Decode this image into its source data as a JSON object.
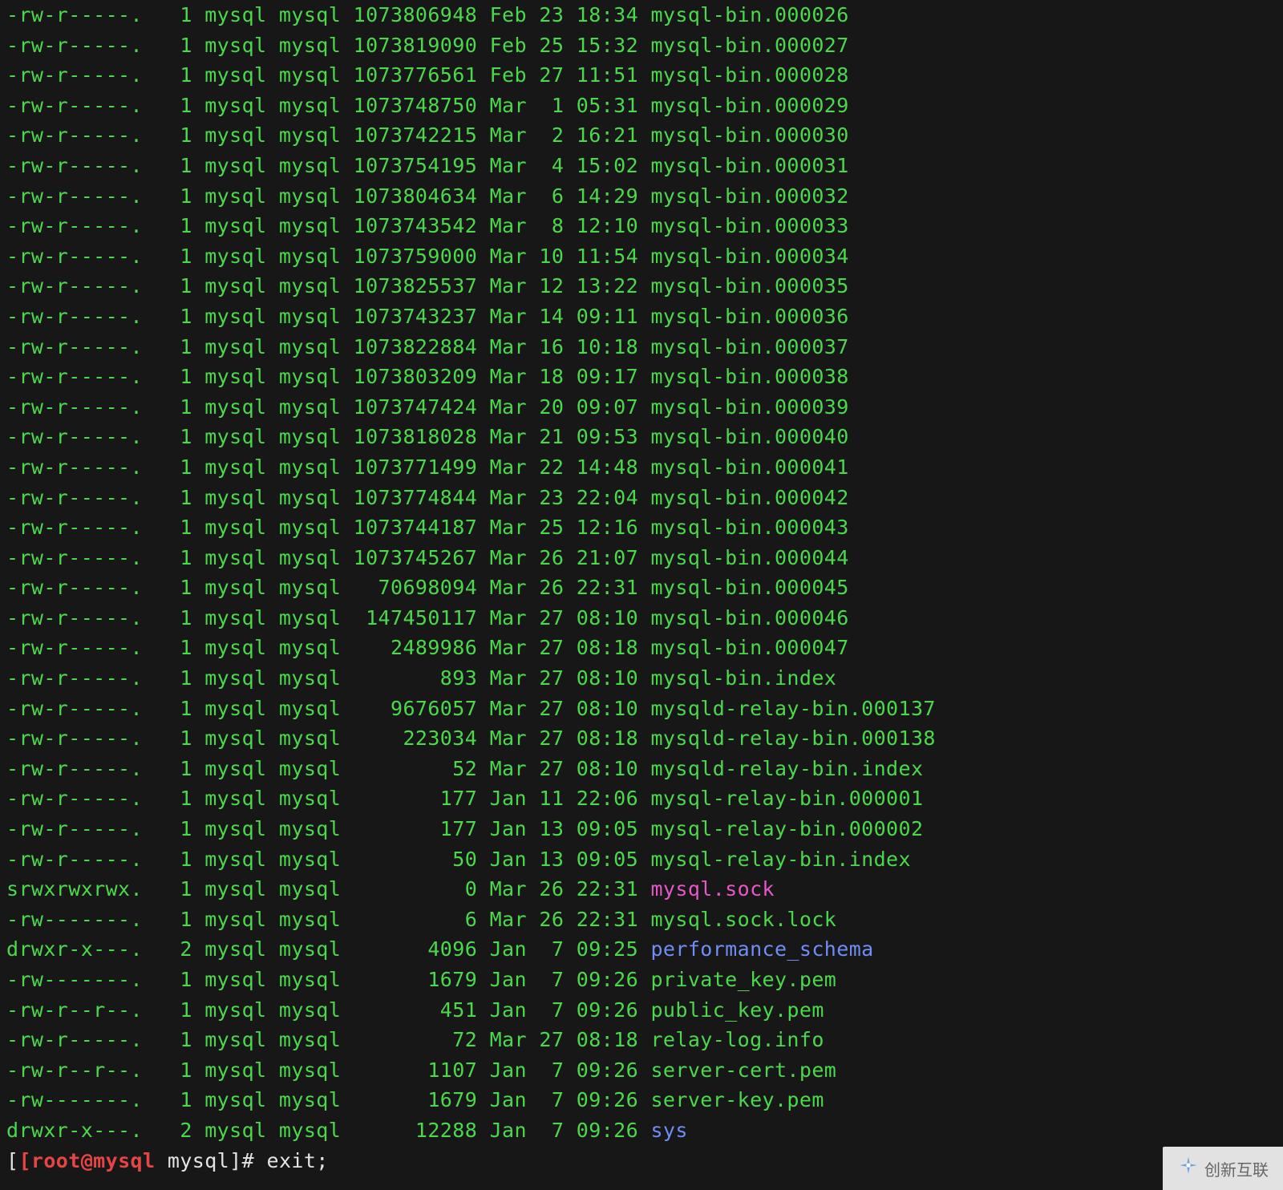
{
  "colors": {
    "fg": "#4bd94b",
    "magenta": "#e857c9",
    "blue": "#6f8ef5",
    "white": "#e4e4e4",
    "red": "#e74545",
    "bg": "#171717"
  },
  "listing": [
    {
      "perm": "-rw-r-----.",
      "links": "1",
      "owner": "mysql",
      "group": "mysql",
      "size": "1073806948",
      "date": "Feb 23 18:34",
      "name": "mysql-bin.000026",
      "cls": ""
    },
    {
      "perm": "-rw-r-----.",
      "links": "1",
      "owner": "mysql",
      "group": "mysql",
      "size": "1073819090",
      "date": "Feb 25 15:32",
      "name": "mysql-bin.000027",
      "cls": ""
    },
    {
      "perm": "-rw-r-----.",
      "links": "1",
      "owner": "mysql",
      "group": "mysql",
      "size": "1073776561",
      "date": "Feb 27 11:51",
      "name": "mysql-bin.000028",
      "cls": ""
    },
    {
      "perm": "-rw-r-----.",
      "links": "1",
      "owner": "mysql",
      "group": "mysql",
      "size": "1073748750",
      "date": "Mar  1 05:31",
      "name": "mysql-bin.000029",
      "cls": ""
    },
    {
      "perm": "-rw-r-----.",
      "links": "1",
      "owner": "mysql",
      "group": "mysql",
      "size": "1073742215",
      "date": "Mar  2 16:21",
      "name": "mysql-bin.000030",
      "cls": ""
    },
    {
      "perm": "-rw-r-----.",
      "links": "1",
      "owner": "mysql",
      "group": "mysql",
      "size": "1073754195",
      "date": "Mar  4 15:02",
      "name": "mysql-bin.000031",
      "cls": ""
    },
    {
      "perm": "-rw-r-----.",
      "links": "1",
      "owner": "mysql",
      "group": "mysql",
      "size": "1073804634",
      "date": "Mar  6 14:29",
      "name": "mysql-bin.000032",
      "cls": ""
    },
    {
      "perm": "-rw-r-----.",
      "links": "1",
      "owner": "mysql",
      "group": "mysql",
      "size": "1073743542",
      "date": "Mar  8 12:10",
      "name": "mysql-bin.000033",
      "cls": ""
    },
    {
      "perm": "-rw-r-----.",
      "links": "1",
      "owner": "mysql",
      "group": "mysql",
      "size": "1073759000",
      "date": "Mar 10 11:54",
      "name": "mysql-bin.000034",
      "cls": ""
    },
    {
      "perm": "-rw-r-----.",
      "links": "1",
      "owner": "mysql",
      "group": "mysql",
      "size": "1073825537",
      "date": "Mar 12 13:22",
      "name": "mysql-bin.000035",
      "cls": ""
    },
    {
      "perm": "-rw-r-----.",
      "links": "1",
      "owner": "mysql",
      "group": "mysql",
      "size": "1073743237",
      "date": "Mar 14 09:11",
      "name": "mysql-bin.000036",
      "cls": ""
    },
    {
      "perm": "-rw-r-----.",
      "links": "1",
      "owner": "mysql",
      "group": "mysql",
      "size": "1073822884",
      "date": "Mar 16 10:18",
      "name": "mysql-bin.000037",
      "cls": ""
    },
    {
      "perm": "-rw-r-----.",
      "links": "1",
      "owner": "mysql",
      "group": "mysql",
      "size": "1073803209",
      "date": "Mar 18 09:17",
      "name": "mysql-bin.000038",
      "cls": ""
    },
    {
      "perm": "-rw-r-----.",
      "links": "1",
      "owner": "mysql",
      "group": "mysql",
      "size": "1073747424",
      "date": "Mar 20 09:07",
      "name": "mysql-bin.000039",
      "cls": ""
    },
    {
      "perm": "-rw-r-----.",
      "links": "1",
      "owner": "mysql",
      "group": "mysql",
      "size": "1073818028",
      "date": "Mar 21 09:53",
      "name": "mysql-bin.000040",
      "cls": ""
    },
    {
      "perm": "-rw-r-----.",
      "links": "1",
      "owner": "mysql",
      "group": "mysql",
      "size": "1073771499",
      "date": "Mar 22 14:48",
      "name": "mysql-bin.000041",
      "cls": ""
    },
    {
      "perm": "-rw-r-----.",
      "links": "1",
      "owner": "mysql",
      "group": "mysql",
      "size": "1073774844",
      "date": "Mar 23 22:04",
      "name": "mysql-bin.000042",
      "cls": ""
    },
    {
      "perm": "-rw-r-----.",
      "links": "1",
      "owner": "mysql",
      "group": "mysql",
      "size": "1073744187",
      "date": "Mar 25 12:16",
      "name": "mysql-bin.000043",
      "cls": ""
    },
    {
      "perm": "-rw-r-----.",
      "links": "1",
      "owner": "mysql",
      "group": "mysql",
      "size": "1073745267",
      "date": "Mar 26 21:07",
      "name": "mysql-bin.000044",
      "cls": ""
    },
    {
      "perm": "-rw-r-----.",
      "links": "1",
      "owner": "mysql",
      "group": "mysql",
      "size": "70698094",
      "date": "Mar 26 22:31",
      "name": "mysql-bin.000045",
      "cls": ""
    },
    {
      "perm": "-rw-r-----.",
      "links": "1",
      "owner": "mysql",
      "group": "mysql",
      "size": "147450117",
      "date": "Mar 27 08:10",
      "name": "mysql-bin.000046",
      "cls": ""
    },
    {
      "perm": "-rw-r-----.",
      "links": "1",
      "owner": "mysql",
      "group": "mysql",
      "size": "2489986",
      "date": "Mar 27 08:18",
      "name": "mysql-bin.000047",
      "cls": ""
    },
    {
      "perm": "-rw-r-----.",
      "links": "1",
      "owner": "mysql",
      "group": "mysql",
      "size": "893",
      "date": "Mar 27 08:10",
      "name": "mysql-bin.index",
      "cls": ""
    },
    {
      "perm": "-rw-r-----.",
      "links": "1",
      "owner": "mysql",
      "group": "mysql",
      "size": "9676057",
      "date": "Mar 27 08:10",
      "name": "mysqld-relay-bin.000137",
      "cls": ""
    },
    {
      "perm": "-rw-r-----.",
      "links": "1",
      "owner": "mysql",
      "group": "mysql",
      "size": "223034",
      "date": "Mar 27 08:18",
      "name": "mysqld-relay-bin.000138",
      "cls": ""
    },
    {
      "perm": "-rw-r-----.",
      "links": "1",
      "owner": "mysql",
      "group": "mysql",
      "size": "52",
      "date": "Mar 27 08:10",
      "name": "mysqld-relay-bin.index",
      "cls": ""
    },
    {
      "perm": "-rw-r-----.",
      "links": "1",
      "owner": "mysql",
      "group": "mysql",
      "size": "177",
      "date": "Jan 11 22:06",
      "name": "mysql-relay-bin.000001",
      "cls": ""
    },
    {
      "perm": "-rw-r-----.",
      "links": "1",
      "owner": "mysql",
      "group": "mysql",
      "size": "177",
      "date": "Jan 13 09:05",
      "name": "mysql-relay-bin.000002",
      "cls": ""
    },
    {
      "perm": "-rw-r-----.",
      "links": "1",
      "owner": "mysql",
      "group": "mysql",
      "size": "50",
      "date": "Jan 13 09:05",
      "name": "mysql-relay-bin.index",
      "cls": ""
    },
    {
      "perm": "srwxrwxrwx.",
      "links": "1",
      "owner": "mysql",
      "group": "mysql",
      "size": "0",
      "date": "Mar 26 22:31",
      "name": "mysql.sock",
      "cls": "magenta"
    },
    {
      "perm": "-rw-------.",
      "links": "1",
      "owner": "mysql",
      "group": "mysql",
      "size": "6",
      "date": "Mar 26 22:31",
      "name": "mysql.sock.lock",
      "cls": ""
    },
    {
      "perm": "drwxr-x---.",
      "links": "2",
      "owner": "mysql",
      "group": "mysql",
      "size": "4096",
      "date": "Jan  7 09:25",
      "name": "performance_schema",
      "cls": "blue"
    },
    {
      "perm": "-rw-------.",
      "links": "1",
      "owner": "mysql",
      "group": "mysql",
      "size": "1679",
      "date": "Jan  7 09:26",
      "name": "private_key.pem",
      "cls": ""
    },
    {
      "perm": "-rw-r--r--.",
      "links": "1",
      "owner": "mysql",
      "group": "mysql",
      "size": "451",
      "date": "Jan  7 09:26",
      "name": "public_key.pem",
      "cls": ""
    },
    {
      "perm": "-rw-r-----.",
      "links": "1",
      "owner": "mysql",
      "group": "mysql",
      "size": "72",
      "date": "Mar 27 08:18",
      "name": "relay-log.info",
      "cls": ""
    },
    {
      "perm": "-rw-r--r--.",
      "links": "1",
      "owner": "mysql",
      "group": "mysql",
      "size": "1107",
      "date": "Jan  7 09:26",
      "name": "server-cert.pem",
      "cls": ""
    },
    {
      "perm": "-rw-------.",
      "links": "1",
      "owner": "mysql",
      "group": "mysql",
      "size": "1679",
      "date": "Jan  7 09:26",
      "name": "server-key.pem",
      "cls": ""
    },
    {
      "perm": "drwxr-x---.",
      "links": "2",
      "owner": "mysql",
      "group": "mysql",
      "size": "12288",
      "date": "Jan  7 09:26",
      "name": "sys",
      "cls": "blue"
    }
  ],
  "prompt": {
    "bracket_open": "[",
    "user_host": "[root@mysql",
    "cwd": " mysql",
    "bracket_close": "]# ",
    "command": "exit;"
  },
  "watermark": {
    "text": "创新互联"
  }
}
